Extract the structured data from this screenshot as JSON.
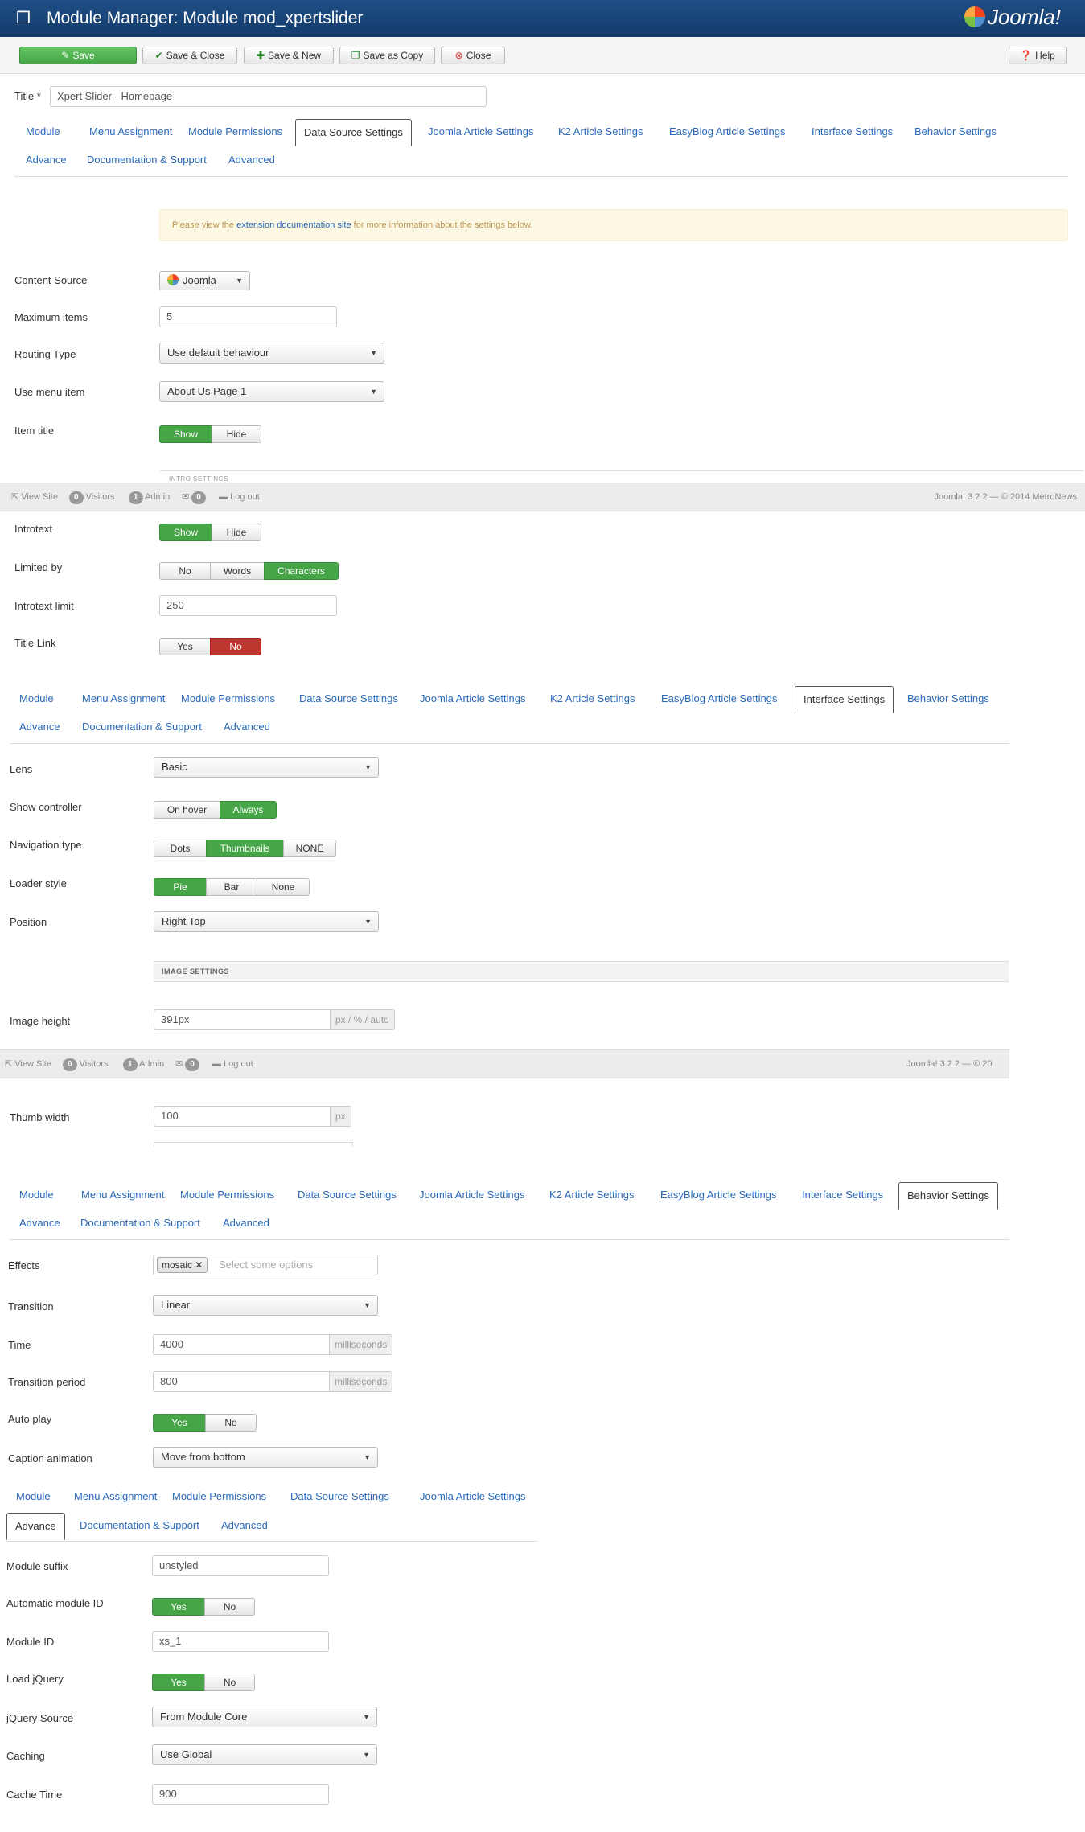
{
  "header": {
    "title": "Module Manager: Module mod_xpertslider",
    "brand": "Joomla!"
  },
  "toolbar": {
    "save": "Save",
    "save_close": "Save & Close",
    "save_new": "Save & New",
    "save_copy": "Save as Copy",
    "close": "Close",
    "help": "Help"
  },
  "title_field": {
    "label": "Title *",
    "value": "Xpert Slider - Homepage"
  },
  "tabs": {
    "module": "Module",
    "menu_assignment": "Menu Assignment",
    "module_permissions": "Module Permissions",
    "data_source": "Data Source Settings",
    "joomla_article": "Joomla Article Settings",
    "k2_article": "K2 Article Settings",
    "easyblog_article": "EasyBlog Article Settings",
    "interface": "Interface Settings",
    "behavior": "Behavior Settings",
    "advance": "Advance",
    "documentation": "Documentation & Support",
    "advanced": "Advanced"
  },
  "notice": {
    "pre": "Please view the ",
    "link": "extension documentation site",
    "post": " for more information about the settings below."
  },
  "data_source": {
    "content_source": {
      "label": "Content Source",
      "value": "Joomla"
    },
    "max_items": {
      "label": "Maximum items",
      "value": "5"
    },
    "routing_type": {
      "label": "Routing Type",
      "value": "Use default behaviour"
    },
    "use_menu_item": {
      "label": "Use menu item",
      "value": "About Us Page 1"
    },
    "item_title": {
      "label": "Item title",
      "options": [
        "Show",
        "Hide"
      ],
      "selected": "Show"
    },
    "intro_heading": "INTRO SETTINGS",
    "introtext": {
      "label": "Introtext",
      "options": [
        "Show",
        "Hide"
      ],
      "selected": "Show"
    },
    "limited_by": {
      "label": "Limited by",
      "options": [
        "No",
        "Words",
        "Characters"
      ],
      "selected": "Characters"
    },
    "introtext_limit": {
      "label": "Introtext limit",
      "value": "250"
    },
    "title_link": {
      "label": "Title Link",
      "options": [
        "Yes",
        "No"
      ],
      "selected": "No"
    }
  },
  "statusbar": {
    "view_site": "View Site",
    "visitors_count": "0",
    "visitors": "Visitors",
    "admin_count": "1",
    "admin": "Admin",
    "messages_count": "0",
    "logout": "Log out",
    "footer": "Joomla! 3.2.2 — © 2014 MetroNews",
    "footer_cut": "Joomla! 3.2.2 — © 20"
  },
  "interface": {
    "lens": {
      "label": "Lens",
      "value": "Basic"
    },
    "show_controller": {
      "label": "Show controller",
      "options": [
        "On hover",
        "Always"
      ],
      "selected": "Always"
    },
    "navigation_type": {
      "label": "Navigation type",
      "options": [
        "Dots",
        "Thumbnails",
        "NONE"
      ],
      "selected": "Thumbnails"
    },
    "loader_style": {
      "label": "Loader style",
      "options": [
        "Pie",
        "Bar",
        "None"
      ],
      "selected": "Pie"
    },
    "position": {
      "label": "Position",
      "value": "Right Top"
    },
    "image_heading": "IMAGE SETTINGS",
    "image_height": {
      "label": "Image height",
      "value": "391px",
      "unit": "px / % / auto"
    },
    "thumb_width": {
      "label": "Thumb width",
      "value": "100",
      "unit": "px"
    }
  },
  "behavior": {
    "effects": {
      "label": "Effects",
      "chip": "mosaic",
      "placeholder": "Select some options"
    },
    "transition": {
      "label": "Transition",
      "value": "Linear"
    },
    "time": {
      "label": "Time",
      "value": "4000",
      "unit": "milliseconds"
    },
    "transition_period": {
      "label": "Transition period",
      "value": "800",
      "unit": "milliseconds"
    },
    "auto_play": {
      "label": "Auto play",
      "options": [
        "Yes",
        "No"
      ],
      "selected": "Yes"
    },
    "caption_animation": {
      "label": "Caption animation",
      "value": "Move from bottom"
    }
  },
  "advance": {
    "module_suffix": {
      "label": "Module suffix",
      "value": "unstyled"
    },
    "auto_module_id": {
      "label": "Automatic module ID",
      "options": [
        "Yes",
        "No"
      ],
      "selected": "Yes"
    },
    "module_id": {
      "label": "Module ID",
      "value": "xs_1"
    },
    "load_jquery": {
      "label": "Load jQuery",
      "options": [
        "Yes",
        "No"
      ],
      "selected": "Yes"
    },
    "jquery_source": {
      "label": "jQuery Source",
      "value": "From Module Core"
    },
    "caching": {
      "label": "Caching",
      "value": "Use Global"
    },
    "cache_time": {
      "label": "Cache Time",
      "value": "900"
    }
  }
}
